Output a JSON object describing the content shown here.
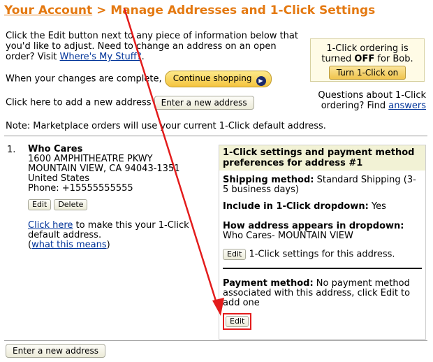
{
  "header": {
    "account_link": "Your Account",
    "separator": " > ",
    "title": "Manage Addresses and 1-Click Settings"
  },
  "intro": {
    "text": "Click the Edit button next to any piece of information below that you'd like to adjust. Need to change an address on an open order? Visit ",
    "link": "Where's My Stuff?",
    "after": "."
  },
  "continue": {
    "text": "When your changes are complete,",
    "button": "Continue shopping"
  },
  "add_new": {
    "text": "Click here to add a new address",
    "button": "Enter a new address"
  },
  "note": "Note: Marketplace orders will use your current 1-Click default address.",
  "oneclick_box": {
    "line1": "1-Click ordering is",
    "line2_pre": "turned ",
    "line2_strong": "OFF",
    "line2_post": " for Bob.",
    "button": "Turn 1-Click on"
  },
  "questions": {
    "text": "Questions about 1-Click ordering? Find ",
    "link": "answers"
  },
  "address": {
    "number": "1.",
    "name": "Who Cares",
    "line1": "1600 AMPHITHEATRE PKWY",
    "line2": "MOUNTAIN VIEW, CA 94043-1351",
    "country": "United States",
    "phone": "Phone: +15555555555",
    "edit": "Edit",
    "delete": "Delete",
    "make_default_link": "Click here",
    "make_default_text": " to make this your 1-Click default address.",
    "what_means_open": "(",
    "what_means_link": "what this means",
    "what_means_close": ")"
  },
  "panel": {
    "heading": "1-Click settings and payment method preferences for address #1",
    "shipping_label": "Shipping method:",
    "shipping_value": " Standard Shipping (3-5 business days)",
    "include_label": "Include in 1-Click dropdown:",
    "include_value": " Yes",
    "appears_label": "How address appears in dropdown:",
    "appears_value": " Who Cares- MOUNTAIN VIEW",
    "settings_edit": "Edit",
    "settings_text": "1-Click settings for this address.",
    "payment_label": "Payment method:",
    "payment_value": " No payment method associated with this address, click Edit to add one",
    "payment_edit": "Edit"
  },
  "bottom": {
    "button": "Enter a new address"
  },
  "colors": {
    "title": "#e47911",
    "link": "#003399",
    "highlight": "#e31c1c",
    "panel_header": "#f2f2d5"
  }
}
